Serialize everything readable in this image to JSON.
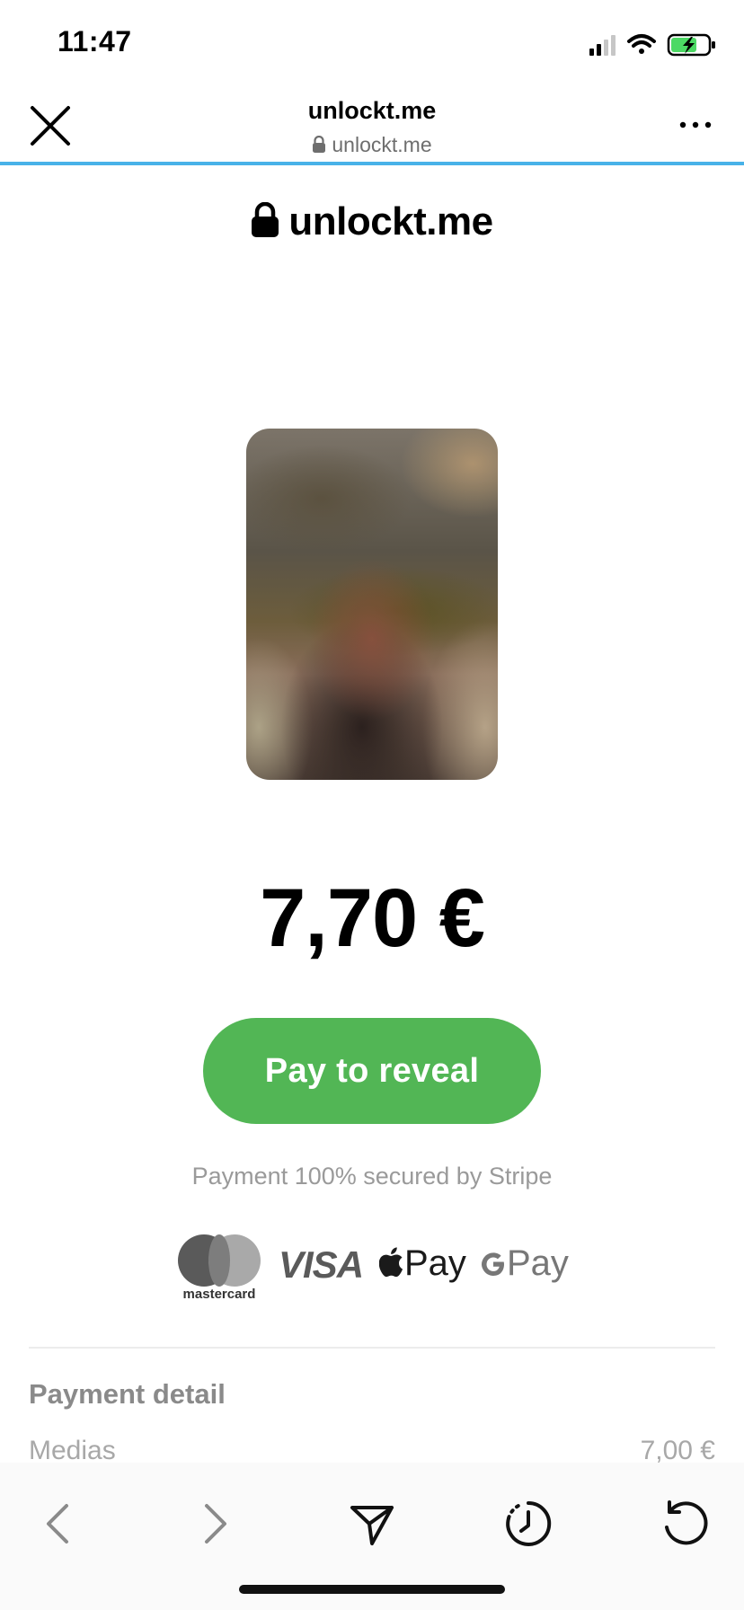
{
  "status_bar": {
    "time": "11:47"
  },
  "browser": {
    "title": "unlockt.me",
    "url": "unlockt.me"
  },
  "brand": {
    "name": "unlockt.me"
  },
  "content": {
    "price": "7,70 €",
    "pay_button": "Pay to reveal",
    "secured_text": "Payment 100% secured by Stripe",
    "payment_methods": {
      "mastercard": "mastercard",
      "visa": "VISA",
      "apple_pay": "Pay",
      "google_pay": "Pay"
    }
  },
  "payment_detail": {
    "title": "Payment detail",
    "rows": [
      {
        "label": "Medias",
        "value": "7,00 €"
      }
    ]
  },
  "toolbar": {
    "icons": [
      "back-arrow-icon",
      "forward-arrow-icon",
      "share-icon",
      "history-icon",
      "reload-icon"
    ]
  }
}
